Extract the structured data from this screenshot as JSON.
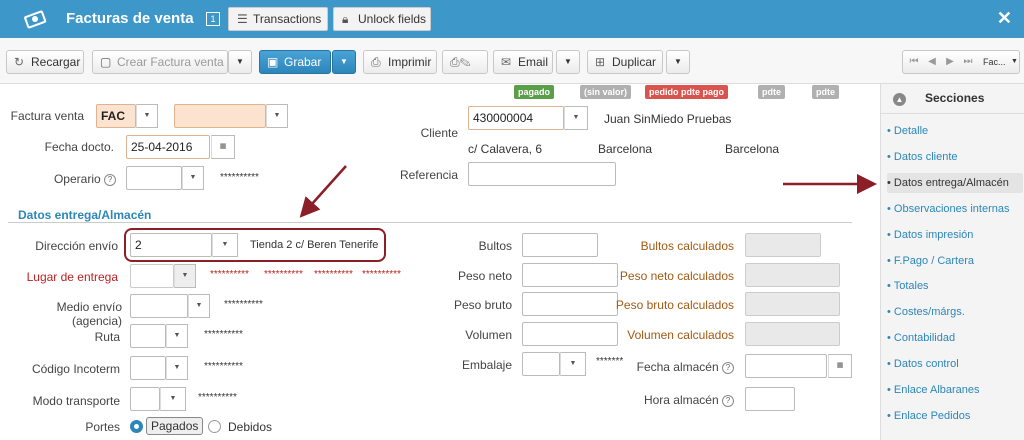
{
  "titlebar": {
    "title": "Facturas de venta",
    "badge": "1",
    "transactions_label": "Transactions",
    "unlock_label": "Unlock fields",
    "close_symbol": "✕",
    "bg_color": "#3d97c9"
  },
  "toolbar": {
    "reload_label": "Recargar",
    "create_label": "Crear Factura venta",
    "save_label": "Grabar",
    "print_label": "Imprimir",
    "email_label": "Email",
    "duplicate_label": "Duplicar",
    "nav_select": "Fac..."
  },
  "status_tags": [
    {
      "label": "pagado",
      "color": "#5a9e4a"
    },
    {
      "label": "(sin valor)",
      "color": "#b0b0b0"
    },
    {
      "label": "pedido pdte pago",
      "color": "#d9534f"
    },
    {
      "label": "pdte",
      "color": "#b0b0b0"
    },
    {
      "label": "pdte",
      "color": "#b0b0b0"
    }
  ],
  "header": {
    "invoice_label": "Factura venta",
    "invoice_series": "FAC",
    "date_label": "Fecha docto.",
    "date_value": "25-04-2016",
    "operator_label": "Operario",
    "operator_stars": "**********",
    "client_label": "Cliente",
    "client_code": "430000004",
    "client_name": "Juan SinMiedo Pruebas",
    "client_address": "c/ Calavera, 6",
    "client_city1": "Barcelona",
    "client_city2": "Barcelona",
    "reference_label": "Referencia"
  },
  "delivery": {
    "section_title": "Datos entrega/Almacén",
    "address_label": "Dirección envío",
    "address_value": "2",
    "address_text": "Tienda 2 c/ Beren Tenerife",
    "place_label": "Lugar de entrega",
    "place_stars": [
      "**********",
      "**********",
      "**********",
      "**********"
    ],
    "carrier_label": "Medio envío (agencia)",
    "carrier_stars": "**********",
    "route_label": "Ruta",
    "route_stars": "**********",
    "incoterm_label": "Código Incoterm",
    "incoterm_stars": "**********",
    "transport_label": "Modo transporte",
    "transport_stars": "**********",
    "portes_label": "Portes",
    "portes_paid": "Pagados",
    "portes_due": "Debidos",
    "packages_label": "Bultos",
    "net_weight_label": "Peso neto",
    "gross_weight_label": "Peso bruto",
    "volume_label": "Volumen",
    "packaging_label": "Embalaje",
    "packaging_stars": "*******",
    "packages_calc_label": "Bultos calculados",
    "net_calc_label": "Peso neto calculados",
    "gross_calc_label": "Peso bruto calculados",
    "volume_calc_label": "Volumen calculados",
    "warehouse_date_label": "Fecha almacén",
    "warehouse_time_label": "Hora almacén"
  },
  "sidebar": {
    "title": "Secciones",
    "items": [
      {
        "label": "• Detalle"
      },
      {
        "label": "• Datos cliente"
      },
      {
        "label": "• Datos entrega/Almacén"
      },
      {
        "label": "• Observaciones internas"
      },
      {
        "label": "• Datos impresión"
      },
      {
        "label": "• F.Pago / Cartera"
      },
      {
        "label": "• Totales"
      },
      {
        "label": "• Costes/márgs."
      },
      {
        "label": "• Contabilidad"
      },
      {
        "label": "• Datos control"
      },
      {
        "label": "• Enlace Albaranes"
      },
      {
        "label": "• Enlace Pedidos"
      }
    ]
  }
}
